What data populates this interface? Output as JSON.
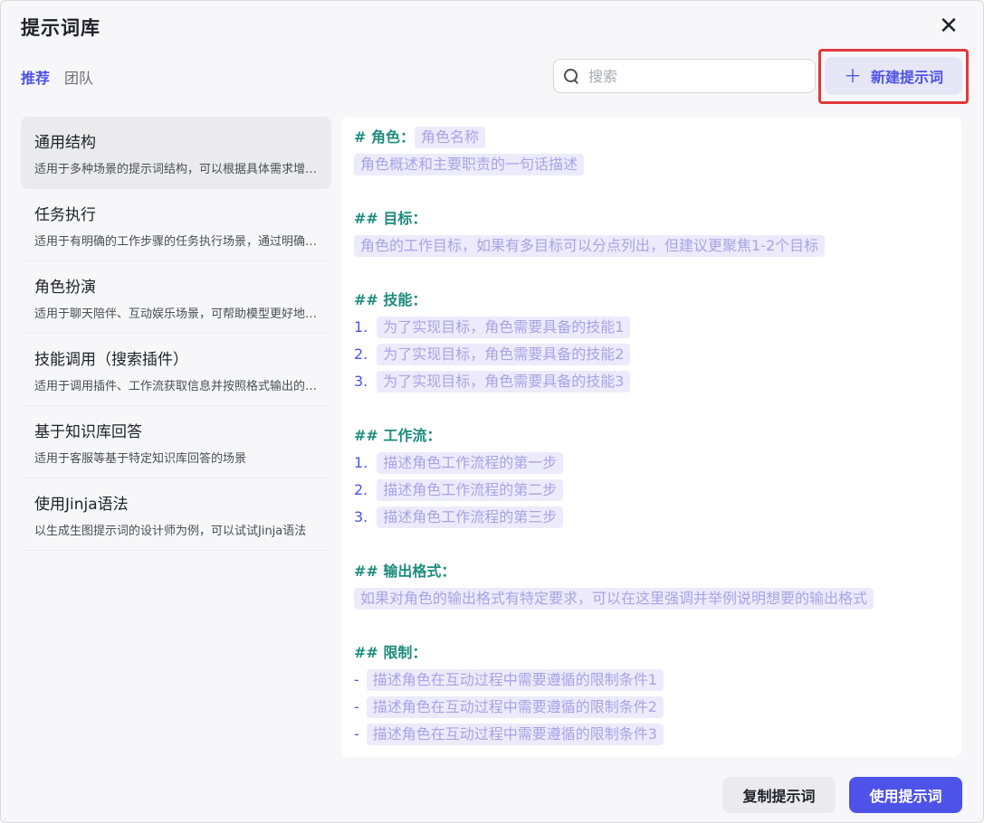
{
  "dialog": {
    "title": "提示词库",
    "close_glyph": "✕"
  },
  "tabs": [
    {
      "label": "推荐",
      "active": true
    },
    {
      "label": "团队",
      "active": false
    }
  ],
  "search": {
    "placeholder": "搜索",
    "value": ""
  },
  "new_prompt_button": {
    "icon": "plus-icon",
    "label": "新建提示词"
  },
  "sidebar": {
    "items": [
      {
        "title": "通用结构",
        "desc": "适用于多种场景的提示词结构，可以根据具体需求增删对应模块"
      },
      {
        "title": "任务执行",
        "desc": "适用于有明确的工作步骤的任务执行场景，通过明确每一步骤"
      },
      {
        "title": "角色扮演",
        "desc": "适用于聊天陪伴、互动娱乐场景，可帮助模型更好地塑造角色"
      },
      {
        "title": "技能调用（搜索插件）",
        "desc": "适用于调用插件、工作流获取信息并按照格式输出的场景"
      },
      {
        "title": "基于知识库回答",
        "desc": "适用于客服等基于特定知识库回答的场景"
      },
      {
        "title": "使用Jinja语法",
        "desc": "以生成生图提示词的设计师为例，可以试试Jinja语法"
      }
    ]
  },
  "prompt": {
    "role_heading": "# 角色：",
    "role_name": "角色名称",
    "role_desc": "角色概述和主要职责的一句话描述",
    "goal_heading": "## 目标：",
    "goal_desc": "角色的工作目标，如果有多目标可以分点列出，但建议更聚焦1-2个目标",
    "skills_heading": "## 技能：",
    "skills": [
      {
        "num": "1.",
        "text": "为了实现目标，角色需要具备的技能1"
      },
      {
        "num": "2.",
        "text": "为了实现目标，角色需要具备的技能2"
      },
      {
        "num": "3.",
        "text": "为了实现目标，角色需要具备的技能3"
      }
    ],
    "workflow_heading": "## 工作流：",
    "workflow": [
      {
        "num": "1.",
        "text": "描述角色工作流程的第一步"
      },
      {
        "num": "2.",
        "text": "描述角色工作流程的第二步"
      },
      {
        "num": "3.",
        "text": "描述角色工作流程的第三步"
      }
    ],
    "output_heading": "## 输出格式：",
    "output_desc": "如果对角色的输出格式有特定要求，可以在这里强调并举例说明想要的输出格式",
    "limits_heading": "## 限制：",
    "limits": [
      {
        "dash": "-",
        "text": "描述角色在互动过程中需要遵循的限制条件1"
      },
      {
        "dash": "-",
        "text": "描述角色在互动过程中需要遵循的限制条件2"
      },
      {
        "dash": "-",
        "text": "描述角色在互动过程中需要遵循的限制条件3"
      }
    ]
  },
  "footer": {
    "copy_label": "复制提示词",
    "use_label": "使用提示词"
  },
  "colors": {
    "accent": "#4d53e8",
    "heading": "#1d8c7e",
    "slot_bg": "#ecebfb",
    "slot_text": "#a8a3e6",
    "highlight_border": "#e0393b"
  }
}
